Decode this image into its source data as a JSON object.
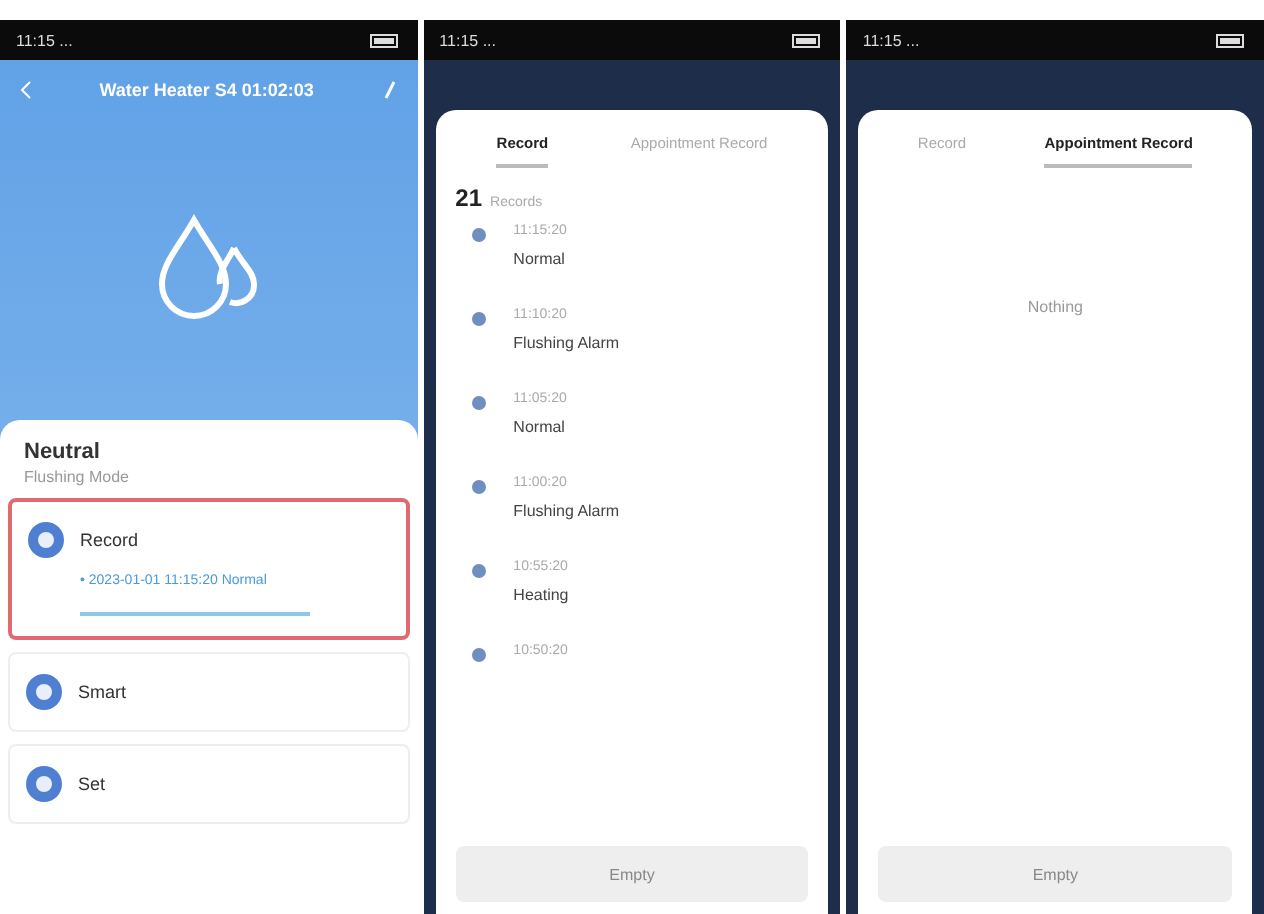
{
  "screens": [
    {
      "kind": "device",
      "status_time": "11:15 ...",
      "header": {
        "title": "Water Heater S4 01:02:03"
      },
      "mode": {
        "name": "Neutral",
        "subtitle": "Flushing Mode"
      },
      "options": [
        {
          "label": "Record",
          "highlighted": true,
          "detail": "• 2023-01-01 11:15:20 Normal"
        },
        {
          "label": "Smart",
          "highlighted": false
        },
        {
          "label": "Set",
          "highlighted": false
        }
      ]
    },
    {
      "kind": "records",
      "status_time": "11:15 ...",
      "tabs": [
        {
          "label": "Record",
          "selected": true
        },
        {
          "label": "Appointment Record",
          "selected": false
        }
      ],
      "count": "21",
      "count_label": "Records",
      "records": [
        {
          "time": "11:15:20",
          "status": "Normal"
        },
        {
          "time": "11:10:20",
          "status": "Flushing Alarm"
        },
        {
          "time": "11:05:20",
          "status": "Normal"
        },
        {
          "time": "11:00:20",
          "status": "Flushing Alarm"
        },
        {
          "time": "10:55:20",
          "status": "Heating"
        },
        {
          "time": "10:50:20"
        }
      ],
      "button": "Empty"
    },
    {
      "kind": "records",
      "status_time": "11:15 ...",
      "tabs": [
        {
          "label": "Record",
          "selected": false
        },
        {
          "label": "Appointment Record",
          "selected": true
        }
      ],
      "empty_text": "Nothing",
      "button": "Empty"
    }
  ]
}
